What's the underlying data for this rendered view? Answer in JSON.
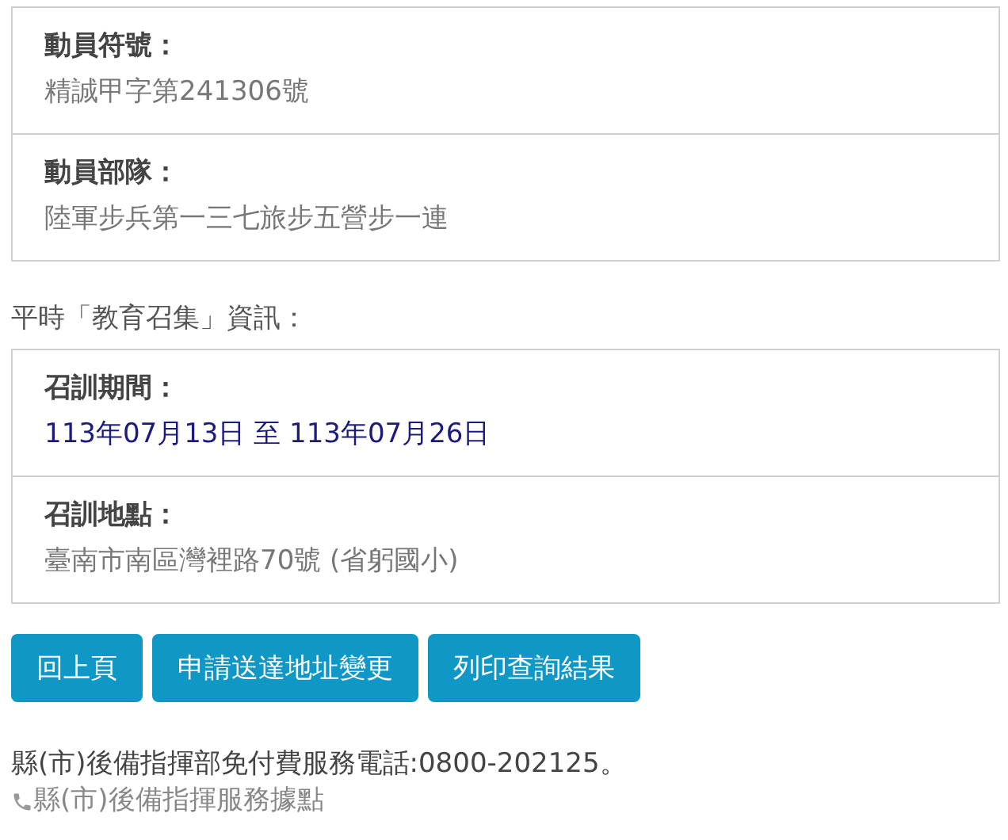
{
  "panels": [
    {
      "fields": [
        {
          "label": "動員符號：",
          "value": "精誠甲字第241306號",
          "highlighted": false
        },
        {
          "label": "動員部隊：",
          "value": "陸軍步兵第一三七旅步五營步一連",
          "highlighted": false
        }
      ]
    },
    {
      "heading": "平時「教育召集」資訊：",
      "fields": [
        {
          "label": "召訓期間：",
          "value": "113年07月13日 至 113年07月26日",
          "highlighted": true
        },
        {
          "label": "召訓地點：",
          "value": "臺南市南區灣裡路70號 (省躬國小)",
          "highlighted": false
        }
      ]
    }
  ],
  "buttons": [
    "回上頁",
    "申請送達地址變更",
    "列印查詢結果"
  ],
  "footer": {
    "hotline": "縣(市)後備指揮部免付費服務電話:0800-202125。",
    "link": "縣(市)後備指揮服務據點"
  }
}
